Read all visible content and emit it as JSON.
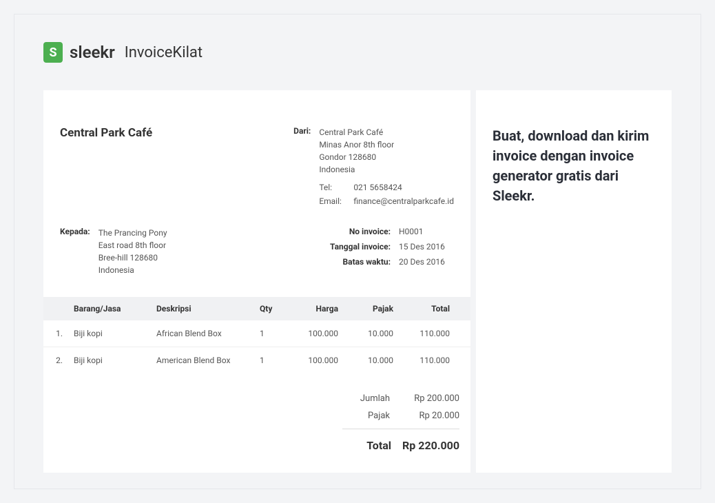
{
  "brand": {
    "logo_letter": "S",
    "logo_text": "sleekr",
    "product_name": "InvoiceKilat"
  },
  "invoice": {
    "company_title": "Central Park Café",
    "from_label": "Dari:",
    "from": {
      "name": "Central Park Café",
      "address1": "Minas Anor 8th floor",
      "address2": "Gondor 128680",
      "country": "Indonesia"
    },
    "tel_label": "Tel:",
    "tel_value": "021 5658424",
    "email_label": "Email:",
    "email_value": "finance@centralparkcafe.id",
    "to_label": "Kepada:",
    "to": {
      "name": "The Prancing Pony",
      "address1": "East road 8th floor",
      "address2": "Bree-hill 128680",
      "country": "Indonesia"
    },
    "meta": {
      "no_label": "No invoice:",
      "no_value": "H0001",
      "date_label": "Tanggal invoice:",
      "date_value": "15 Des 2016",
      "due_label": "Batas waktu:",
      "due_value": "20 Des 2016"
    },
    "columns": {
      "item": "Barang/Jasa",
      "desc": "Deskripsi",
      "qty": "Qty",
      "price": "Harga",
      "tax": "Pajak",
      "total": "Total"
    },
    "rows": [
      {
        "num": "1.",
        "item": "Biji kopi",
        "desc": "African Blend Box",
        "qty": "1",
        "price": "100.000",
        "tax": "10.000",
        "total": "110.000"
      },
      {
        "num": "2.",
        "item": "Biji kopi",
        "desc": "American Blend Box",
        "qty": "1",
        "price": "100.000",
        "tax": "10.000",
        "total": "110.000"
      }
    ],
    "totals": {
      "subtotal_label": "Jumlah",
      "subtotal_value": "Rp 200.000",
      "tax_label": "Pajak",
      "tax_value": "Rp 20.000",
      "grand_label": "Total",
      "grand_value": "Rp 220.000"
    }
  },
  "sidebar": {
    "headline": "Buat, download dan kirim invoice dengan invoice generator gratis dari Sleekr."
  }
}
